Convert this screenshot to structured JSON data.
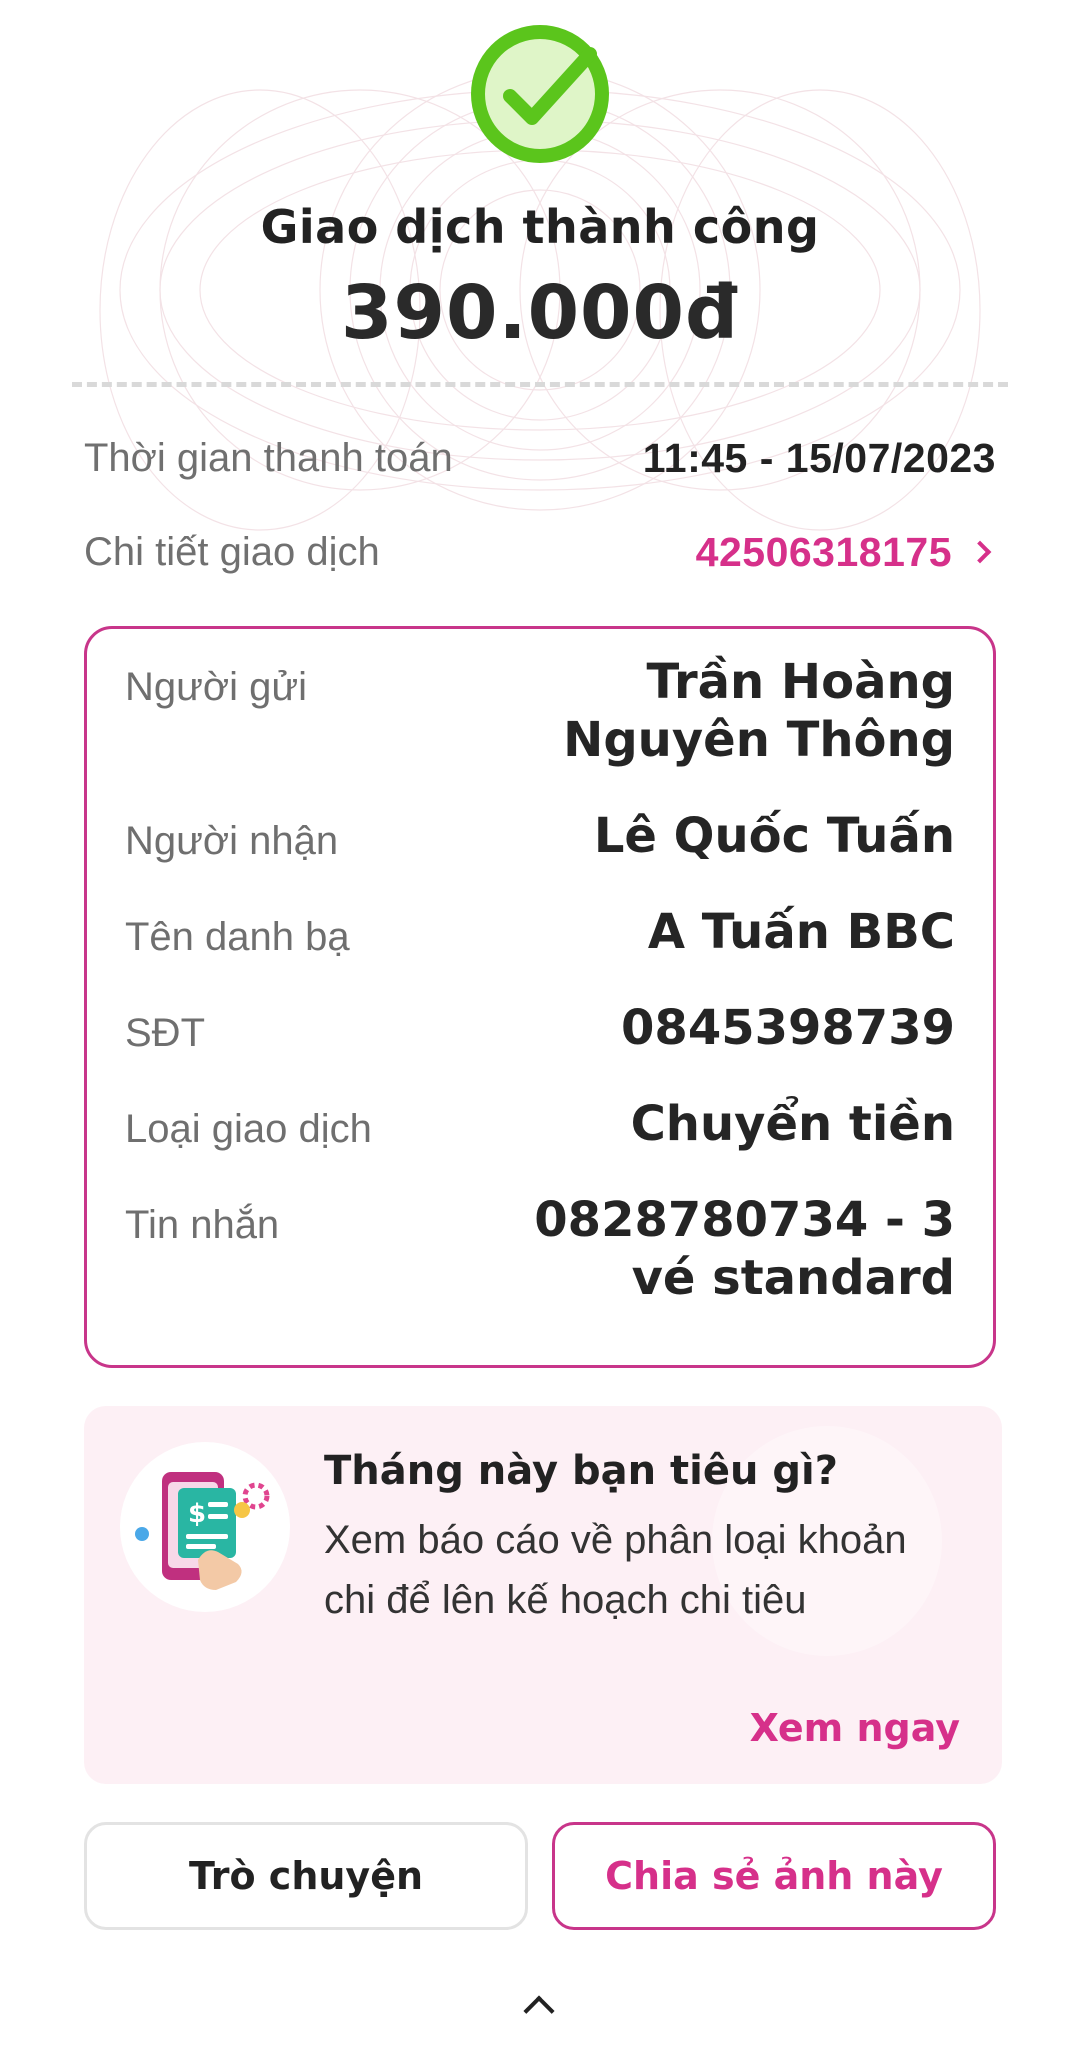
{
  "status": {
    "title": "Giao dịch thành công",
    "amount": "390.000đ"
  },
  "summary": {
    "time_label": "Thời gian thanh toán",
    "time_value": "11:45 - 15/07/2023",
    "detail_label": "Chi tiết giao dịch",
    "detail_value": "42506318175"
  },
  "details": {
    "sender_label": "Người gửi",
    "sender_value": "Trần Hoàng Nguyên Thông",
    "receiver_label": "Người nhận",
    "receiver_value": "Lê Quốc Tuấn",
    "contact_label": "Tên danh bạ",
    "contact_value": "A Tuấn BBC",
    "phone_label": "SĐT",
    "phone_value": "0845398739",
    "type_label": "Loại giao dịch",
    "type_value": "Chuyển tiền",
    "message_label": "Tin nhắn",
    "message_value": "0828780734 - 3 vé standard"
  },
  "promo": {
    "title": "Tháng này bạn tiêu gì?",
    "description": "Xem báo cáo về phân loại khoản chi để lên kế hoạch chi tiêu",
    "link": "Xem ngay",
    "icon": "expense-report-icon"
  },
  "actions": {
    "chat_label": "Trò chuyện",
    "share_label": "Chia sẻ ảnh này"
  },
  "colors": {
    "accent": "#d6308a",
    "border": "#c8358a",
    "success": "#5bc51c",
    "success_light": "#dff5c8"
  }
}
